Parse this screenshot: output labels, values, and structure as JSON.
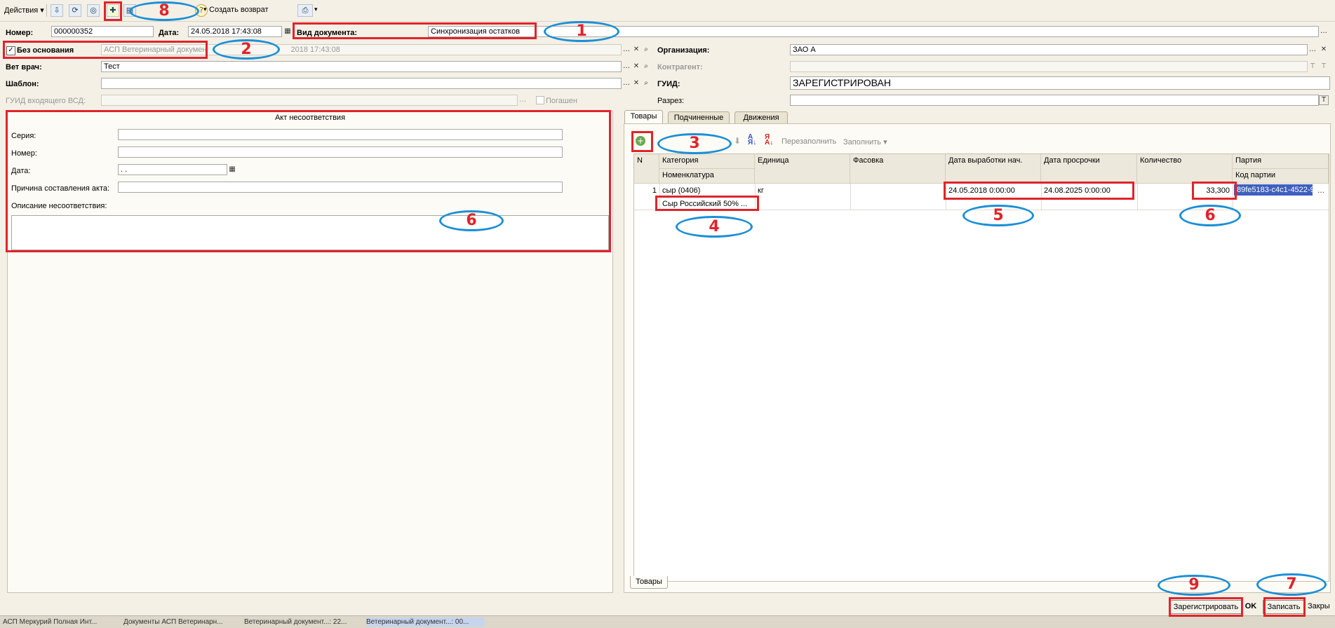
{
  "toolbar": {
    "actions_label": "Действия",
    "create_return_label": "Создать возврат"
  },
  "header": {
    "number_label": "Номер:",
    "number_value": "000000352",
    "date_label": "Дата:",
    "date_value": "24.05.2018 17:43:08",
    "doc_type_label": "Вид документа:",
    "doc_type_value": "Синхронизация остатков",
    "no_base_label": "Без основания",
    "base_value": "АСП Ветеринарный докумен",
    "base_date": "2018 17:43:08",
    "vet_label": "Вет врач:",
    "vet_value": "Тест",
    "template_label": "Шаблон:",
    "guid_in_label": "ГУИД входящего ВСД:",
    "paid_label": "Погашен",
    "org_label": "Организация:",
    "org_value": "ЗАО  А",
    "counterparty_label": "Контрагент:",
    "guid_label": "ГУИД:",
    "guid_value": "ЗАРЕГИСТРИРОВАН",
    "cut_label": "Разрез:"
  },
  "act": {
    "title": "Акт несоответствия",
    "series_label": "Серия:",
    "number_label": "Номер:",
    "date_label": "Дата:",
    "date_value": " .  .",
    "reason_label": "Причина составления акта:",
    "description_label": "Описание несоответствия:"
  },
  "tabs": [
    {
      "label": "Товары"
    },
    {
      "label": "Подчиненные"
    },
    {
      "label": "Движения"
    }
  ],
  "grid_toolbar": {
    "refill_label": "Перезаполнить",
    "fill_label": "Заполнить"
  },
  "grid": {
    "columns": {
      "n": "N",
      "category": "Категория",
      "nomenclature": "Номенклатура",
      "unit": "Единица",
      "packing": "Фасовка",
      "prod_date": "Дата выработки нач.",
      "expiry": "Дата просрочки",
      "qty": "Количество",
      "batch": "Партия",
      "batch_code": "Код партии"
    },
    "rows": [
      {
        "n": "1",
        "category": "сыр (0406)",
        "nomenclature": "Сыр Российский 50% ...",
        "unit": "кг",
        "packing": "",
        "prod_date": "24.05.2018 0:00:00",
        "expiry": "24.08.2025 0:00:00",
        "qty": "33,300",
        "batch_code": "89fe5183-c4c1-4522-9"
      }
    ]
  },
  "bottom_tab": "Товары",
  "buttons": {
    "register": "Зарегистрировать",
    "ok": "OK",
    "save": "Записать",
    "close": "Закры"
  },
  "annotations": [
    "1",
    "2",
    "3",
    "4",
    "5",
    "6",
    "6",
    "7",
    "8",
    "9"
  ],
  "taskbar": [
    {
      "label": "АСП Меркурий Полная Инт..."
    },
    {
      "label": "Документы АСП Ветеринарн..."
    },
    {
      "label": "Ветеринарный документ...: 22..."
    },
    {
      "label": "Ветеринарный документ...: 00..."
    }
  ],
  "colors": {
    "annotation_red": "#e0242a",
    "annotation_blue": "#1b8fd6",
    "background": "#f4f0e6",
    "selection": "#3f5fbf"
  }
}
